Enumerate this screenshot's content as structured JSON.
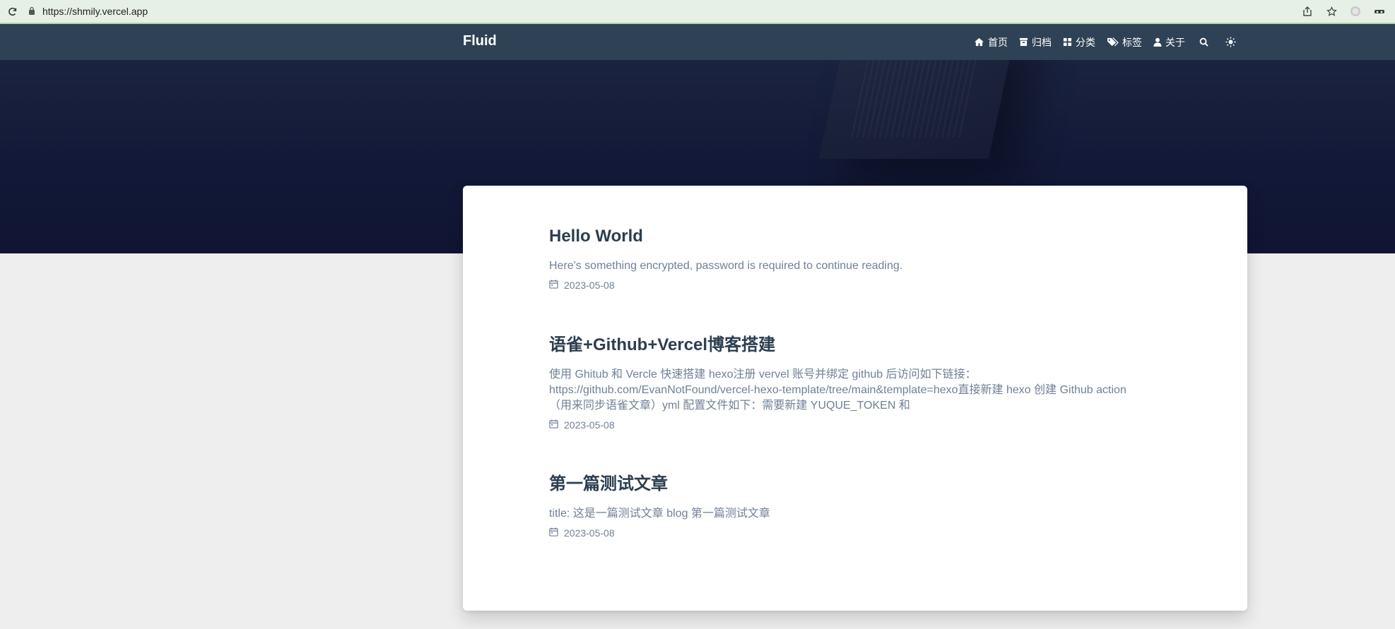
{
  "browser": {
    "url": "https://shmily.vercel.app",
    "icons": [
      "reload-icon",
      "lock-icon",
      "share-icon",
      "bookmark-star-icon",
      "profile-icon",
      "incognito-icon"
    ]
  },
  "site": {
    "brand": "Fluid",
    "nav": [
      {
        "label": "首页",
        "icon": "home-icon"
      },
      {
        "label": "归档",
        "icon": "archive-icon"
      },
      {
        "label": "分类",
        "icon": "category-icon"
      },
      {
        "label": "标签",
        "icon": "tags-icon"
      },
      {
        "label": "关于",
        "icon": "user-icon"
      }
    ],
    "nav_icons": [
      "search-icon",
      "theme-toggle-sun-icon"
    ]
  },
  "posts": [
    {
      "title": "Hello World",
      "excerpt": "Here's something encrypted, password is required to continue reading.",
      "date": "2023-05-08"
    },
    {
      "title": "语雀+Github+Vercel博客搭建",
      "excerpt": "使用 Ghitub 和 Vercle 快速搭建 hexo注册 vervel 账号并绑定 github 后访问如下链接：https://github.com/EvanNotFound/vercel-hexo-template/tree/main&template=hexo直接新建 hexo 创建 Github action（用来同步语雀文章）yml 配置文件如下：需要新建 YUQUE_TOKEN 和",
      "date": "2023-05-08"
    },
    {
      "title": "第一篇测试文章",
      "excerpt": "title: 这是一篇测试文章 blog 第一篇测试文章",
      "date": "2023-05-08"
    }
  ],
  "colors": {
    "nav_bg": "#2f4154",
    "hero_bg": "#121938",
    "title": "#2c3e50",
    "text_muted": "#718096",
    "page_bg": "#eeeeee"
  }
}
